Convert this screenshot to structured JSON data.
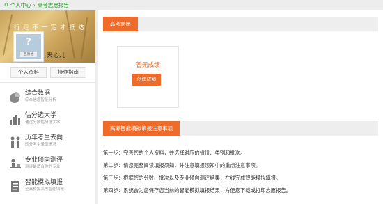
{
  "breadcrumb": {
    "home": "个人中心",
    "current": "高考志愿报告"
  },
  "profile": {
    "banner_slogan": "行 走 不 一 定 才 抵 达",
    "avatar_tag": "志愿通",
    "username": "夹心儿",
    "buttons": {
      "profile": "个人资料",
      "guide": "操作指南"
    }
  },
  "sidebar": {
    "items": [
      {
        "title": "综合数据",
        "subtitle": "综合信息智能分析",
        "icon": "pie-chart-icon"
      },
      {
        "title": "估分选大学",
        "subtitle": "通过分数估分选大学",
        "icon": "bar-chart-icon"
      },
      {
        "title": "历年考生去向",
        "subtitle": "同分考生录取情况",
        "icon": "people-icon"
      },
      {
        "title": "专业倾向测评",
        "subtitle": "测评最适合你的专业",
        "icon": "person-desk-icon"
      },
      {
        "title": "智能模拟填报",
        "subtitle": "全真模拟高考智能填报",
        "icon": "document-icon"
      }
    ]
  },
  "main": {
    "section1": {
      "title": "高考志愿",
      "empty_text": "暂无成绩",
      "create_label": "创建成绩"
    },
    "section2": {
      "title": "高考智能模拟填报注意事项",
      "steps": [
        "第一步：完善您的个人资料，并选择对应的省份、类别和批次。",
        "第二步：请您完整阅读填报须知，并注意填报须知中的重点注意事项。",
        "第三步：根据您的分数、批次以及专业倾向测评结果，在线完成智能模拟填报。",
        "第四步：系统会为您保存您当前的智能模拟填报结果，方便您下载或打印志愿报告。"
      ]
    }
  },
  "colors": {
    "accent": "#ee6b2a",
    "breadcrumb": "#2e9b2e"
  }
}
